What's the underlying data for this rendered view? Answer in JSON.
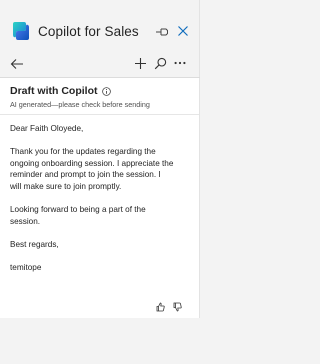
{
  "app": {
    "title": "Copilot for Sales"
  },
  "toolbar": {
    "back_icon": "arrow-left-icon",
    "add_icon": "plus-icon",
    "search_icon": "search-icon",
    "more_icon": "more-horizontal-icon"
  },
  "draft": {
    "title": "Draft with Copilot",
    "disclaimer": "AI generated—please check before sending",
    "greeting": "Dear Faith Oloyede,",
    "body_lines": [
      "Thank you for the updates regarding the",
      "ongoing onboarding session. I appreciate the",
      "reminder and prompt to join the session. I",
      "will make sure to join promptly."
    ],
    "closing_lines": [
      "Looking forward to being a part of the",
      "session."
    ],
    "signoff": "Best regards,",
    "signature": "temitope"
  },
  "colors": {
    "accent": "#0f6cbd",
    "background": "#f3f3f3",
    "card": "#ffffff"
  }
}
